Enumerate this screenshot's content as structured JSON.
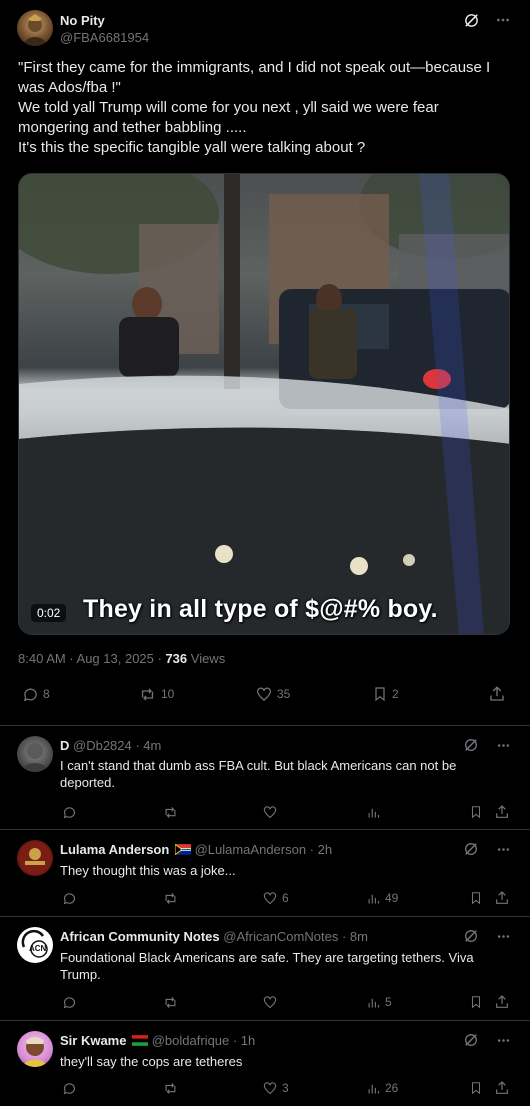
{
  "main_post": {
    "author_name": "No Pity",
    "author_handle": "@FBA6681954",
    "text": "\"First they came for the immigrants, and I did not speak out—because I was Ados/fba !\"\nWe told yall Trump will come for you next , yll said we were fear mongering and tether babbling .....\nIt's this the specific tangible yall were talking about ?",
    "video_time": "0:02",
    "video_caption": "They in all type of $@#% boy.",
    "timestamp": "8:40 AM · Aug 13, 2025 · ",
    "views_count": "736",
    "views_label": " Views",
    "replies": "8",
    "reposts": "10",
    "likes": "35",
    "bookmarks": "2"
  },
  "replies": [
    {
      "name": "D",
      "handle": "@Db2824 · 4m",
      "text": "I can't stand that dumb ass FBA cult. But black Americans can not be deported.",
      "replies": "",
      "reposts": "",
      "likes": "",
      "views": ""
    },
    {
      "name": "Lulama Anderson",
      "handle": "@LulamaAnderson · 2h",
      "text": "They thought this was a joke...",
      "replies": "",
      "reposts": "",
      "likes": "6",
      "views": "49"
    },
    {
      "name": "African Community Notes",
      "handle": "@AfricanComNotes · 8m",
      "text": "Foundational Black Americans are safe. They are targeting tethers. Viva Trump.",
      "avatar_text": "ACN",
      "replies": "",
      "reposts": "",
      "likes": "",
      "views": "5"
    },
    {
      "name": "Sir Kwame",
      "handle": "@boldafrique · 1h",
      "text": "they'll say the cops are tetheres",
      "replies": "",
      "reposts": "",
      "likes": "3",
      "views": "26"
    }
  ],
  "colors": {
    "background": "#000000",
    "text": "#e7e9ea",
    "muted": "#71767b",
    "border": "#2f3336"
  }
}
